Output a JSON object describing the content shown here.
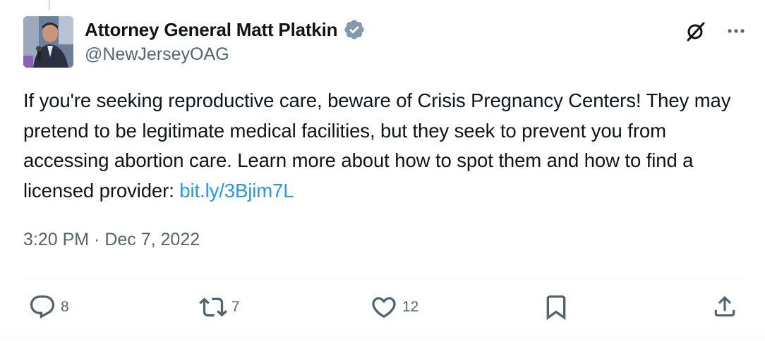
{
  "author": {
    "display_name": "Attorney General Matt Platkin",
    "handle": "@NewJerseyOAG",
    "avatar_icon": "profile-photo",
    "verified_icon": "verified-badge-icon",
    "verified_color": "#829aab"
  },
  "actions_top": {
    "grok_icon": "grok-icon",
    "more_icon": "more-options-icon"
  },
  "tweet": {
    "text": "If you're seeking reproductive care, beware of Crisis Pregnancy Centers! They may pretend to be legitimate medical facilities, but they seek to prevent you from accessing abortion care. Learn more about how to spot them and how to find a licensed provider: ",
    "link_text": "bit.ly/3Bjim7L",
    "link_color": "#1d9bf0",
    "timestamp": "3:20 PM · Dec 7, 2022"
  },
  "engagement": {
    "replies": "8",
    "retweets": "7",
    "likes": "12",
    "reply_icon": "reply-icon",
    "retweet_icon": "retweet-icon",
    "like_icon": "heart-icon",
    "bookmark_icon": "bookmark-icon",
    "share_icon": "share-icon"
  }
}
